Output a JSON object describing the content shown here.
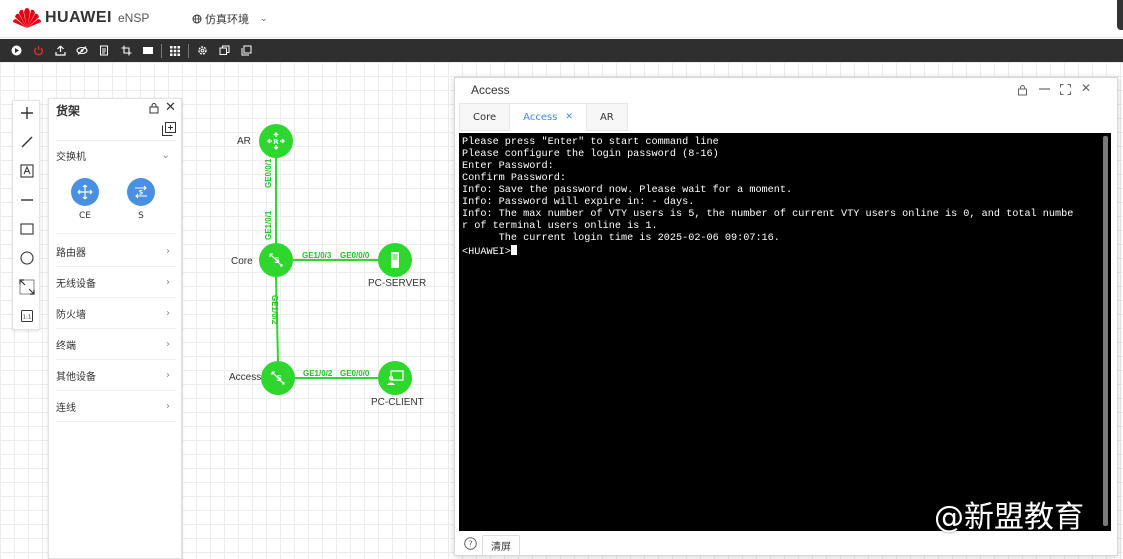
{
  "app": {
    "brand": "HUAWEI",
    "product": "eNSP",
    "environment": "仿真环境"
  },
  "shelf": {
    "title": "货架",
    "switch_category": "交换机",
    "devices": [
      {
        "label": "CE"
      },
      {
        "label": "S"
      }
    ],
    "categories": [
      "路由器",
      "无线设备",
      "防火墙",
      "终端",
      "其他设备",
      "连线"
    ]
  },
  "topology": {
    "nodes": {
      "ar": "AR",
      "core": "Core",
      "access": "Access",
      "pc_server": "PC-SERVER",
      "pc_client": "PC-CLIENT"
    },
    "ports": {
      "ar_down": "GE0/0/1",
      "core_up": "GE1/0/1",
      "core_right": "GE1/0/3",
      "server_left": "GE0/0/0",
      "core_down": "GE1/0/2",
      "access_right": "GE1/0/2",
      "client_left": "GE0/0/0"
    },
    "accent": "#2ed62e"
  },
  "terminal_window": {
    "title": "Access",
    "tabs": [
      {
        "label": "Core"
      },
      {
        "label": "Access"
      },
      {
        "label": "AR"
      }
    ],
    "active_tab": "Access",
    "lines": [
      "Please press \"Enter\" to start command line",
      "",
      "Please configure the login password (8-16)",
      "Enter Password:",
      "Confirm Password:",
      "Info: Save the password now. Please wait for a moment.",
      "Info: Password will expire in: - days.",
      "Info: The max number of VTY users is 5, the number of current VTY users online is 0, and total numbe",
      "r of terminal users online is 1.",
      "      The current login time is 2025-02-06 09:07:16."
    ],
    "prompt": "<HUAWEI>",
    "clear_label": "清屏"
  },
  "watermark": "@新盟教育"
}
